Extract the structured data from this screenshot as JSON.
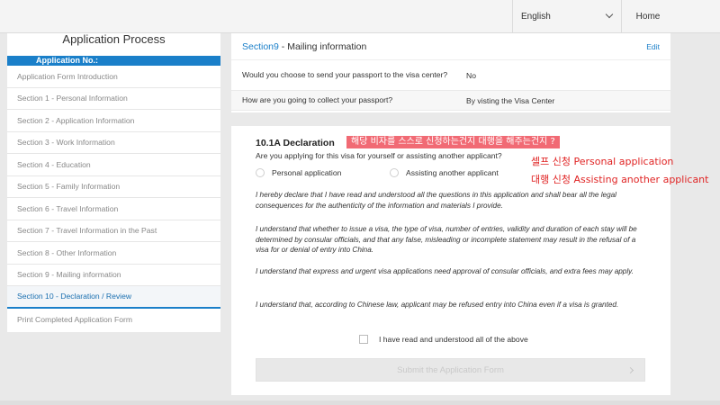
{
  "header": {
    "language": "English",
    "home": "Home"
  },
  "sidebar": {
    "title": "Application Process",
    "app_no_label": "Application No.:",
    "items": [
      {
        "label": "Application Form Introduction"
      },
      {
        "label": "Section 1 - Personal Information"
      },
      {
        "label": "Section 2 - Application Information"
      },
      {
        "label": "Section 3 - Work Information"
      },
      {
        "label": "Section 4 - Education"
      },
      {
        "label": "Section 5 - Family Information"
      },
      {
        "label": "Section 6 - Travel Information"
      },
      {
        "label": "Section 7 - Travel Information in the Past"
      },
      {
        "label": "Section 8 - Other Information"
      },
      {
        "label": "Section 9 - Mailing information"
      },
      {
        "label": "Section 10 - Declaration / Review"
      }
    ],
    "print_label": "Print Completed Application Form"
  },
  "section9": {
    "number": "Section9",
    "title": " - Mailing information",
    "edit": "Edit",
    "rows": [
      {
        "question": "Would you choose to send your passport to the visa center?",
        "answer": "No"
      },
      {
        "question": "How are you going to collect your passport?",
        "answer": "By visting the Visa Center"
      }
    ]
  },
  "declaration": {
    "heading": "10.1A Declaration",
    "question": "Are you applying for this visa for yourself or assisting another applicant?",
    "option_personal": "Personal application",
    "option_assisting": "Assisting another applicant",
    "paragraphs": [
      "I hereby declare that I have read and understood all the questions in this application and shall bear all the legal consequences for the authenticity of the information and materials I provide.",
      "I understand that whether to issue a visa, the type of visa, number of entries, validity and duration of each stay will be determined by consular officials, and that any false, misleading or incomplete statement may result in the refusal of a visa for or denial of entry into China.",
      "I understand that express and urgent visa applications need approval of consular officials, and extra fees may apply.",
      "I understand that, according to Chinese law, applicant may be refused entry into China even if a visa is granted."
    ],
    "checkbox_label": "I have read and understood all of the above",
    "submit_label": "Submit the Application Form"
  },
  "annotations": {
    "box": "해당 비자를 스스로 신청하는건지 대행을 해주는건지 ?",
    "line1": "셀프 신청 Personal application",
    "line2": "대행 신청 Assisting another applicant",
    "color": "#e02424"
  }
}
